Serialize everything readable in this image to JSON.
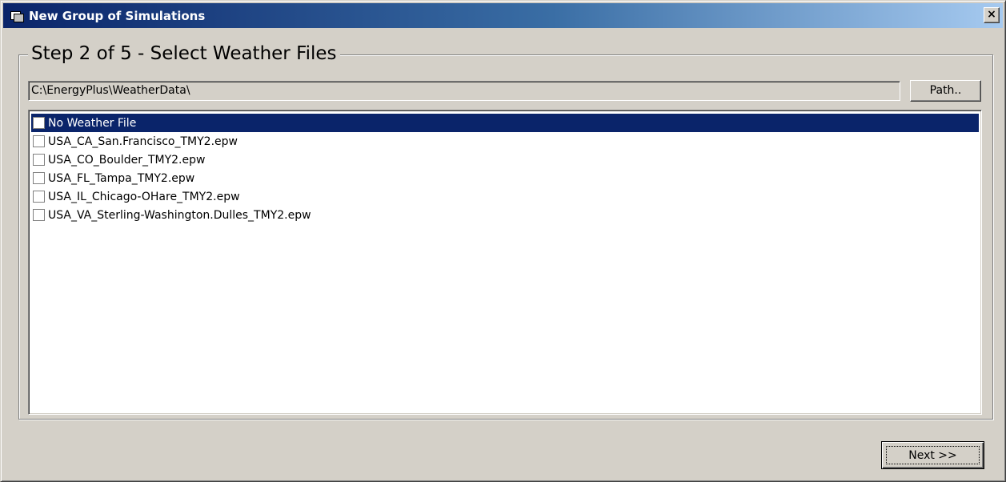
{
  "window": {
    "title": "New Group of Simulations",
    "close_label": "×"
  },
  "step": {
    "heading": "Step 2 of 5 - Select Weather Files"
  },
  "path": {
    "value": "C:\\EnergyPlus\\WeatherData\\",
    "button_label": "Path.."
  },
  "weather_files": {
    "items": [
      {
        "label": "No Weather File",
        "checked": false,
        "selected": true
      },
      {
        "label": "USA_CA_San.Francisco_TMY2.epw",
        "checked": false,
        "selected": false
      },
      {
        "label": "USA_CO_Boulder_TMY2.epw",
        "checked": false,
        "selected": false
      },
      {
        "label": "USA_FL_Tampa_TMY2.epw",
        "checked": false,
        "selected": false
      },
      {
        "label": "USA_IL_Chicago-OHare_TMY2.epw",
        "checked": false,
        "selected": false
      },
      {
        "label": "USA_VA_Sterling-Washington.Dulles_TMY2.epw",
        "checked": false,
        "selected": false
      }
    ]
  },
  "footer": {
    "next_label": "Next >>"
  },
  "colors": {
    "selection": "#0a246a",
    "dialog_face": "#d4d0c8"
  }
}
